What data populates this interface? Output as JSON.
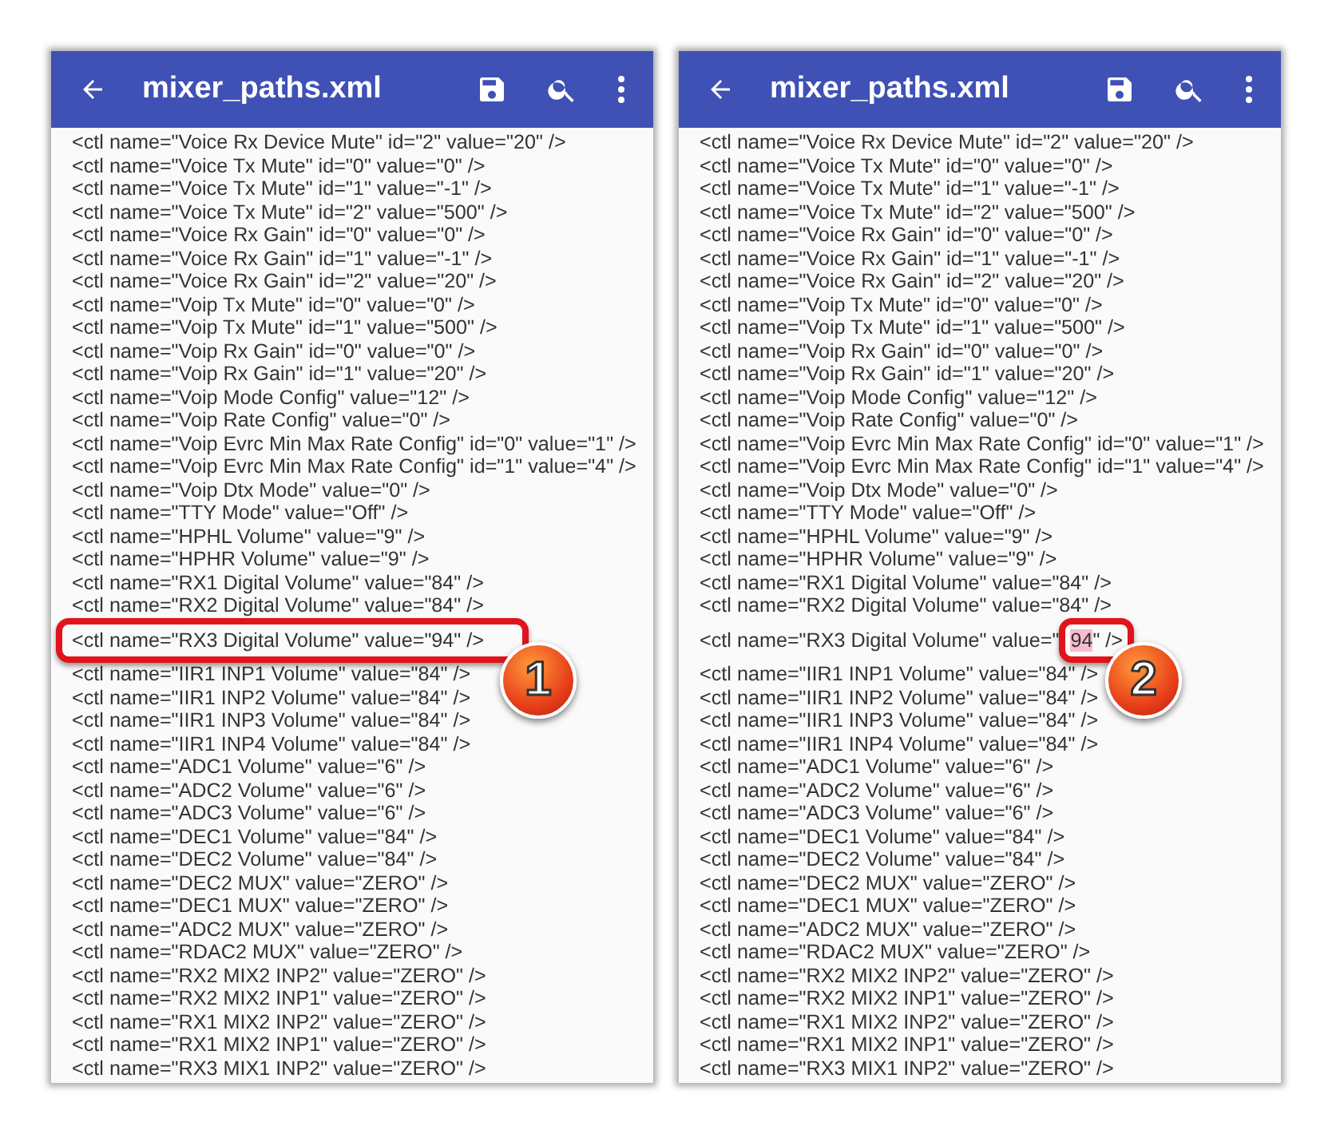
{
  "panels": [
    {
      "title": "mixer_paths.xml",
      "lines": [
        "<ctl name=\"Voice Rx Device Mute\" id=\"2\" value=\"20\" />",
        "<ctl name=\"Voice Tx Mute\" id=\"0\" value=\"0\" />",
        "<ctl name=\"Voice Tx Mute\" id=\"1\" value=\"-1\" />",
        "<ctl name=\"Voice Tx Mute\" id=\"2\" value=\"500\" />",
        "<ctl name=\"Voice Rx Gain\" id=\"0\" value=\"0\" />",
        "<ctl name=\"Voice Rx Gain\" id=\"1\" value=\"-1\" />",
        "<ctl name=\"Voice Rx Gain\" id=\"2\" value=\"20\" />",
        "<ctl name=\"Voip Tx Mute\" id=\"0\" value=\"0\" />",
        "<ctl name=\"Voip Tx Mute\" id=\"1\" value=\"500\" />",
        "<ctl name=\"Voip Rx Gain\" id=\"0\" value=\"0\" />",
        "<ctl name=\"Voip Rx Gain\" id=\"1\" value=\"20\" />",
        "<ctl name=\"Voip Mode Config\" value=\"12\" />",
        "<ctl name=\"Voip Rate Config\" value=\"0\" />",
        "<ctl name=\"Voip Evrc Min Max Rate Config\" id=\"0\" value=\"1\" />",
        "<ctl name=\"Voip Evrc Min Max Rate Config\" id=\"1\" value=\"4\" />",
        "<ctl name=\"Voip Dtx Mode\" value=\"0\" />",
        "<ctl name=\"TTY Mode\" value=\"Off\" />",
        "<ctl name=\"HPHL Volume\" value=\"9\" />",
        "<ctl name=\"HPHR Volume\" value=\"9\" />",
        "<ctl name=\"RX1 Digital Volume\" value=\"84\" />",
        "<ctl name=\"RX2 Digital Volume\" value=\"84\" />",
        {
          "text": "<ctl name=\"RX3 Digital Volume\" value=\"94\" />",
          "callout": "1"
        },
        "<ctl name=\"IIR1 INP1 Volume\" value=\"84\" />",
        "<ctl name=\"IIR1 INP2 Volume\" value=\"84\" />",
        "<ctl name=\"IIR1 INP3 Volume\" value=\"84\" />",
        "<ctl name=\"IIR1 INP4 Volume\" value=\"84\" />",
        "<ctl name=\"ADC1 Volume\" value=\"6\" />",
        "<ctl name=\"ADC2 Volume\" value=\"6\" />",
        "<ctl name=\"ADC3 Volume\" value=\"6\" />",
        "<ctl name=\"DEC1 Volume\" value=\"84\" />",
        "<ctl name=\"DEC2 Volume\" value=\"84\" />",
        "<ctl name=\"DEC2 MUX\" value=\"ZERO\" />",
        "<ctl name=\"DEC1 MUX\" value=\"ZERO\" />",
        "<ctl name=\"ADC2 MUX\" value=\"ZERO\" />",
        "<ctl name=\"RDAC2 MUX\" value=\"ZERO\" />",
        "<ctl name=\"RX2 MIX2 INP2\" value=\"ZERO\" />",
        "<ctl name=\"RX2 MIX2 INP1\" value=\"ZERO\" />",
        "<ctl name=\"RX1 MIX2 INP2\" value=\"ZERO\" />",
        "<ctl name=\"RX1 MIX2 INP1\" value=\"ZERO\" />",
        "<ctl name=\"RX3 MIX1 INP2\" value=\"ZERO\" />"
      ]
    },
    {
      "title": "mixer_paths.xml",
      "lines": [
        "<ctl name=\"Voice Rx Device Mute\" id=\"2\" value=\"20\" />",
        "<ctl name=\"Voice Tx Mute\" id=\"0\" value=\"0\" />",
        "<ctl name=\"Voice Tx Mute\" id=\"1\" value=\"-1\" />",
        "<ctl name=\"Voice Tx Mute\" id=\"2\" value=\"500\" />",
        "<ctl name=\"Voice Rx Gain\" id=\"0\" value=\"0\" />",
        "<ctl name=\"Voice Rx Gain\" id=\"1\" value=\"-1\" />",
        "<ctl name=\"Voice Rx Gain\" id=\"2\" value=\"20\" />",
        "<ctl name=\"Voip Tx Mute\" id=\"0\" value=\"0\" />",
        "<ctl name=\"Voip Tx Mute\" id=\"1\" value=\"500\" />",
        "<ctl name=\"Voip Rx Gain\" id=\"0\" value=\"0\" />",
        "<ctl name=\"Voip Rx Gain\" id=\"1\" value=\"20\" />",
        "<ctl name=\"Voip Mode Config\" value=\"12\" />",
        "<ctl name=\"Voip Rate Config\" value=\"0\" />",
        "<ctl name=\"Voip Evrc Min Max Rate Config\" id=\"0\" value=\"1\" />",
        "<ctl name=\"Voip Evrc Min Max Rate Config\" id=\"1\" value=\"4\" />",
        "<ctl name=\"Voip Dtx Mode\" value=\"0\" />",
        "<ctl name=\"TTY Mode\" value=\"Off\" />",
        "<ctl name=\"HPHL Volume\" value=\"9\" />",
        "<ctl name=\"HPHR Volume\" value=\"9\" />",
        "<ctl name=\"RX1 Digital Volume\" value=\"84\" />",
        "<ctl name=\"RX2 Digital Volume\" value=\"84\" />",
        {
          "before": "<ctl name=\"RX3 Digital Volume\" value=\"",
          "selected": "94",
          "after": "\" />",
          "callout": "2"
        },
        "<ctl name=\"IIR1 INP1 Volume\" value=\"84\" />",
        "<ctl name=\"IIR1 INP2 Volume\" value=\"84\" />",
        "<ctl name=\"IIR1 INP3 Volume\" value=\"84\" />",
        "<ctl name=\"IIR1 INP4 Volume\" value=\"84\" />",
        "<ctl name=\"ADC1 Volume\" value=\"6\" />",
        "<ctl name=\"ADC2 Volume\" value=\"6\" />",
        "<ctl name=\"ADC3 Volume\" value=\"6\" />",
        "<ctl name=\"DEC1 Volume\" value=\"84\" />",
        "<ctl name=\"DEC2 Volume\" value=\"84\" />",
        "<ctl name=\"DEC2 MUX\" value=\"ZERO\" />",
        "<ctl name=\"DEC1 MUX\" value=\"ZERO\" />",
        "<ctl name=\"ADC2 MUX\" value=\"ZERO\" />",
        "<ctl name=\"RDAC2 MUX\" value=\"ZERO\" />",
        "<ctl name=\"RX2 MIX2 INP2\" value=\"ZERO\" />",
        "<ctl name=\"RX2 MIX2 INP1\" value=\"ZERO\" />",
        "<ctl name=\"RX1 MIX2 INP2\" value=\"ZERO\" />",
        "<ctl name=\"RX1 MIX2 INP1\" value=\"ZERO\" />",
        "<ctl name=\"RX3 MIX1 INP2\" value=\"ZERO\" />"
      ]
    }
  ]
}
